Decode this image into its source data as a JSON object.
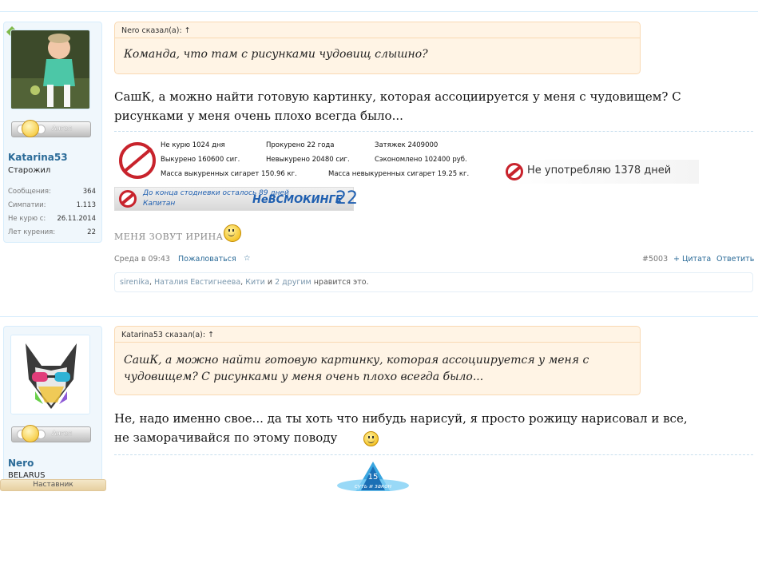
{
  "posts": [
    {
      "user": {
        "name": "Katarina53",
        "title": "Старожил",
        "rank": "Ангел",
        "stats": [
          {
            "label": "Сообщения:",
            "value": "364"
          },
          {
            "label": "Симпатии:",
            "value": "1.113"
          },
          {
            "label": "Не курю с:",
            "value": "26.11.2014"
          },
          {
            "label": "Лет курения:",
            "value": "22"
          }
        ]
      },
      "quote": {
        "author": "Nero сказал(а): ↑",
        "text": "Команда, что там с рисунками чудовищ слышно?"
      },
      "message_lines": [
        "СашК, а можно найти готовую картинку, которая ассоциируется у меня с чудовищем? С",
        "рисунками у меня очень плохо всегда было..."
      ],
      "signature": {
        "counter": {
          "cells": [
            "Не курю 1024 дня",
            "Прокурено 22 года",
            "Затяжек 2409000",
            "Выкурено 160600 сиг.",
            "Невыкурено 20480 сиг.",
            "Сэкономлено 102400 руб.",
            "Масса выкуренных сигарет 150.96 кг.",
            "Масса невыкуренных сигарет 19.25 кг."
          ]
        },
        "nouse": "Не употребляю 1378 дней",
        "marathon": {
          "line1": "До конца стодневки осталось 89 дней",
          "line2": "Капитан",
          "brand": "НеВСМОКИНГЕ",
          "num": "22"
        },
        "my_name": "МЕНЯ ЗОВУТ ИРИНА"
      },
      "meta": {
        "date": "Среда в 09:43",
        "report": "Пожаловаться",
        "star": "☆",
        "post_num": "#5003",
        "quote_btn": "+ Цитата",
        "reply_btn": "Ответить"
      },
      "likes": {
        "users": [
          "sirenika",
          "Наталия Евстигнеева",
          "Кити"
        ],
        "sep1": ", ",
        "sep2": ", ",
        "and": " и ",
        "others": "2 другим",
        "suffix": " нравится это."
      }
    },
    {
      "user": {
        "name": "Nero",
        "title": "BELARUS",
        "rank": "Ангел",
        "rank2": "Наставник"
      },
      "quote": {
        "author": "Katarina53 сказал(а): ↑",
        "lines": [
          "СашК, а можно найти готовую картинку, которая ассоциируется у меня с",
          "чудовищем? С рисунками у меня очень плохо всегда было..."
        ]
      },
      "message_lines": [
        "Не, надо именно свое... да ты хоть что нибудь нарисуй, я просто рожицу нарисовал и все,",
        "не заморачивайся по этому поводу"
      ],
      "badge": {
        "line1": "15",
        "line2": "суть и закон"
      }
    }
  ],
  "colors": {
    "accent": "#2b6b98",
    "quote_bg": "#fff4e5",
    "quote_border": "#f9d9b3",
    "sidebar_bg": "#f0f7fc",
    "nosmoke": "#c8232c"
  }
}
